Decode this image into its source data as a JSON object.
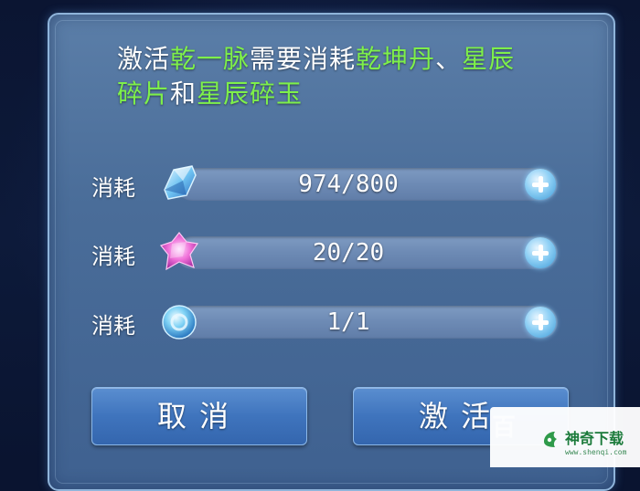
{
  "dialog": {
    "description": {
      "part1": "激活",
      "meridian": "乾一脉",
      "part2": "需要消耗",
      "item1": "乾坤丹",
      "sep": "、",
      "item2a": "星辰",
      "item2b": "碎片",
      "part3": "和",
      "item3": "星辰碎玉"
    },
    "costs": [
      {
        "label": "消耗",
        "icon": "blue-crystal-icon",
        "value": "974/800"
      },
      {
        "label": "消耗",
        "icon": "pink-star-shard-icon",
        "value": "20/20"
      },
      {
        "label": "消耗",
        "icon": "blue-orb-icon",
        "value": "1/1"
      }
    ],
    "cancel_label": "取消",
    "activate_label": "激活"
  },
  "watermark": {
    "ghost": "百",
    "site_name": "神奇下载",
    "url": "www.shenqi.com"
  },
  "colors": {
    "highlight": "#7ef04a",
    "panel": "#4a6d99",
    "button": "#3f74bd"
  }
}
